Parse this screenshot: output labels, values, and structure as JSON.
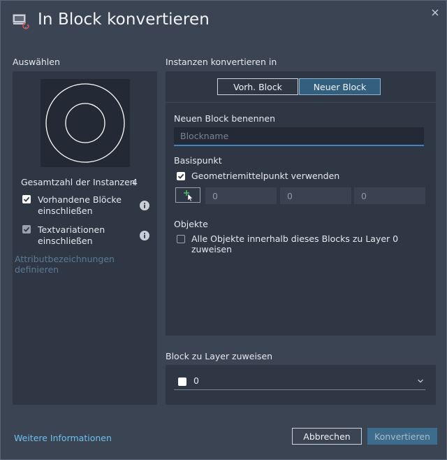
{
  "window": {
    "title": "In Block konvertieren",
    "title_icon": "block-convert-icon",
    "close_icon": "close-icon"
  },
  "left": {
    "section_label": "Auswählen",
    "total_label": "Gesamtzahl der Instanzen",
    "total_value": "4",
    "include_existing": {
      "line1": "Vorhandene Blöcke",
      "line2": "einschließen",
      "checked": true
    },
    "text_variations": {
      "line1": "Textvariationen",
      "line2": "einschließen",
      "checked": true,
      "disabled": true
    },
    "attribute_link": "Attributbezeichnungen definieren"
  },
  "right": {
    "section_label": "Instanzen konvertieren in",
    "seg_existing": "Vorh. Block",
    "seg_new": "Neuer Block",
    "selected_seg": "Neuer Block",
    "name_label": "Neuen Block benennen",
    "name_placeholder": "Blockname",
    "name_value": "",
    "basepoint_label": "Basispunkt",
    "use_center_label": "Geometriemittelpunkt verwenden",
    "use_center_checked": true,
    "coords": [
      "0",
      "0",
      "0"
    ],
    "objects_label": "Objekte",
    "assign_layer0_label": "Alle Objekte innerhalb dieses Blocks zu Layer 0 zuweisen",
    "assign_layer0_checked": false
  },
  "layer": {
    "section_label": "Block zu Layer zuweisen",
    "selected": "0",
    "swatch_color": "#ffffff"
  },
  "footer": {
    "more_info": "Weitere Informationen",
    "cancel": "Abbrechen",
    "convert": "Konvertieren"
  }
}
